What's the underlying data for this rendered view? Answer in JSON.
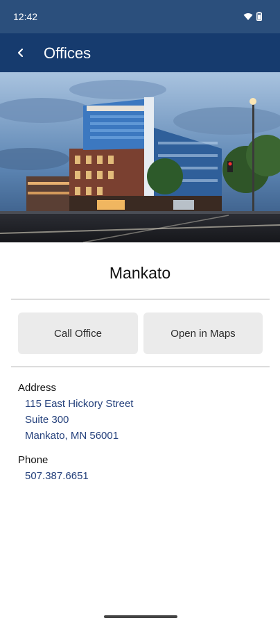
{
  "status_bar": {
    "time": "12:42"
  },
  "app_bar": {
    "title": "Offices"
  },
  "office": {
    "name": "Mankato",
    "actions": {
      "call_label": "Call Office",
      "maps_label": "Open in Maps"
    },
    "address": {
      "label": "Address",
      "lines": [
        "115 East Hickory Street",
        "Suite 300",
        "Mankato, MN 56001"
      ]
    },
    "phone": {
      "label": "Phone",
      "value": "507.387.6651"
    }
  },
  "icons": {
    "back": "arrow-back-icon",
    "wifi": "wifi-icon",
    "battery": "battery-icon"
  },
  "colors": {
    "status_bar": "#2b4f7c",
    "app_bar": "#163b6e",
    "link": "#25417c",
    "button_bg": "#ebebeb"
  }
}
